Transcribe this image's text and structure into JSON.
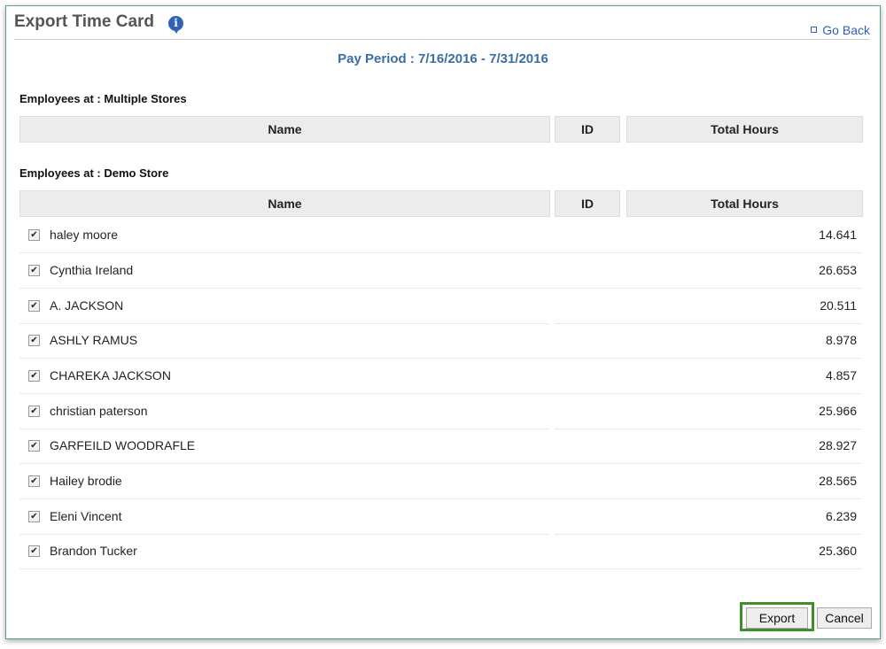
{
  "dialog": {
    "title": "Export Time Card",
    "go_back_label": "Go Back",
    "pay_period": "Pay Period : 7/16/2016 - 7/31/2016"
  },
  "sections": [
    {
      "label": "Employees at : Multiple Stores",
      "columns": [
        "Name",
        "ID",
        "Total Hours"
      ],
      "rows": []
    },
    {
      "label": "Employees at : Demo Store",
      "columns": [
        "Name",
        "ID",
        "Total Hours"
      ],
      "rows": [
        {
          "name": "haley moore",
          "id": "",
          "hours": "14.641",
          "checked": true
        },
        {
          "name": "Cynthia Ireland",
          "id": "",
          "hours": "26.653",
          "checked": true
        },
        {
          "name": "A. JACKSON",
          "id": "",
          "hours": "20.511",
          "checked": true
        },
        {
          "name": "ASHLY RAMUS",
          "id": "",
          "hours": "8.978",
          "checked": true
        },
        {
          "name": "CHAREKA JACKSON",
          "id": "",
          "hours": "4.857",
          "checked": true
        },
        {
          "name": "christian paterson",
          "id": "",
          "hours": "25.966",
          "checked": true
        },
        {
          "name": "GARFEILD WOODRAFLE",
          "id": "",
          "hours": "28.927",
          "checked": true
        },
        {
          "name": "Hailey brodie",
          "id": "",
          "hours": "28.565",
          "checked": true
        },
        {
          "name": "Eleni Vincent",
          "id": "",
          "hours": "6.239",
          "checked": true
        },
        {
          "name": "Brandon Tucker",
          "id": "",
          "hours": "25.360",
          "checked": true
        }
      ]
    }
  ],
  "footer": {
    "export_label": "Export",
    "cancel_label": "Cancel"
  },
  "colors": {
    "frame_border": "#5aa58a",
    "link": "#2e62b5",
    "pay_period": "#3a6ea5",
    "highlight": "#3f8f2c"
  }
}
